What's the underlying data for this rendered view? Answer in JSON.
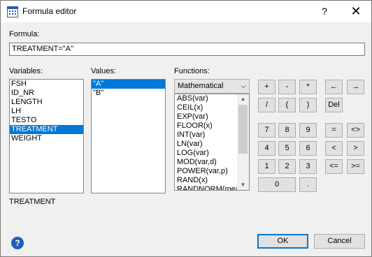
{
  "window": {
    "title": "Formula editor",
    "help_glyph": "?",
    "close_glyph": "✕"
  },
  "formula": {
    "label": "Formula:",
    "value": "TREATMENT=\"A\""
  },
  "variables": {
    "label": "Variables:",
    "items": [
      "FSH",
      "ID_NR",
      "LENGTH",
      "LH",
      "TESTO",
      "TREATMENT",
      "WEIGHT"
    ],
    "selected": "TREATMENT"
  },
  "values": {
    "label": "Values:",
    "items": [
      "\"A\"",
      "\"B\""
    ],
    "selected": "\"A\""
  },
  "functions": {
    "label": "Functions:",
    "category": "Mathematical",
    "items": [
      "ABS(var)",
      "CEIL(x)",
      "EXP(var)",
      "FLOOR(x)",
      "INT(var)",
      "LN(var)",
      "LOG(var)",
      "MOD(var,d)",
      "POWER(var,p)",
      "RAND(x)",
      "RANDNORM(mean"
    ]
  },
  "keypad": {
    "plus": "+",
    "minus": "-",
    "multiply": "*",
    "left_arrow": "←",
    "right_arrow": "→",
    "divide": "/",
    "open_paren": "(",
    "close_paren": ")",
    "del": "Del",
    "d7": "7",
    "d8": "8",
    "d9": "9",
    "eq": "=",
    "ne": "<>",
    "d4": "4",
    "d5": "5",
    "d6": "6",
    "lt": "<",
    "gt": ">",
    "d1": "1",
    "d2": "2",
    "d3": "3",
    "le": "<=",
    "ge": ">=",
    "d0": "0",
    "dot": "."
  },
  "selected_variable_caption": "TREATMENT",
  "buttons": {
    "ok": "OK",
    "cancel": "Cancel"
  },
  "icons": {
    "app": "formula-editor-icon",
    "help": "help-icon"
  }
}
